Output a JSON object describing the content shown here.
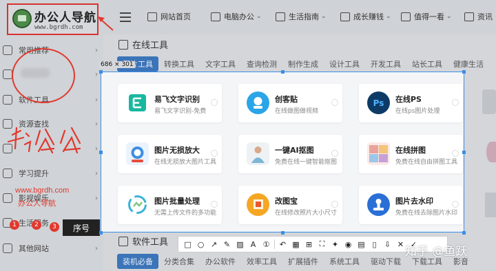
{
  "logo": {
    "title": "办公人导航",
    "url": "www.bgrdh.com"
  },
  "sidebar": {
    "items": [
      {
        "label": "常用推荐"
      },
      {
        "label": ""
      },
      {
        "label": "软件工具"
      },
      {
        "label": "资源查找"
      },
      {
        "label": ""
      },
      {
        "label": "学习提升"
      },
      {
        "label": "影视娱乐"
      },
      {
        "label": "生活服务"
      },
      {
        "label": "其他网站"
      }
    ]
  },
  "topnav": [
    {
      "label": "网站首页",
      "dropdown": false
    },
    {
      "label": "电脑办公",
      "dropdown": true
    },
    {
      "label": "生活指南",
      "dropdown": true
    },
    {
      "label": "成长赚钱",
      "dropdown": true
    },
    {
      "label": "值得一看",
      "dropdown": true
    },
    {
      "label": "资讯",
      "dropdown": false
    }
  ],
  "online_tools": {
    "heading": "在线工具",
    "tabs": [
      "图片工具",
      "转换工具",
      "文字工具",
      "查询检测",
      "制作生成",
      "设计工具",
      "开发工具",
      "站长工具",
      "健康生活"
    ],
    "active_tab": 0
  },
  "software_tools": {
    "heading": "软件工具",
    "tabs": [
      "装机必备",
      "分类合集",
      "办公软件",
      "效率工具",
      "扩展插件",
      "系统工具",
      "驱动下载",
      "下载工具",
      "影音"
    ],
    "active_tab": 0
  },
  "capture": {
    "dimensions": "686 × 301",
    "cards": [
      {
        "title": "易飞文字识别",
        "desc": "易飞文字识别-免费",
        "icon": "text-recognition-icon",
        "color": "#16b7a0"
      },
      {
        "title": "创客贴",
        "desc": "在线做图做视频",
        "icon": "chuangketie-icon",
        "color": "#2aa5e8"
      },
      {
        "title": "在线PS",
        "desc": "在线ps图片处理",
        "icon": "photoshop-icon",
        "color": "#0d3b66"
      },
      {
        "title": "图片无损放大",
        "desc": "在线无损放大图片工具",
        "icon": "image-upscale-icon",
        "color": "#3d8fe0"
      },
      {
        "title": "一键AI抠图",
        "desc": "免费在线一键智能抠图",
        "icon": "ai-cutout-icon",
        "color": "#e9e4de"
      },
      {
        "title": "在线拼图",
        "desc": "免费在线自由拼图工具",
        "icon": "collage-icon",
        "color": "#f2c9c4"
      },
      {
        "title": "图片批量处理",
        "desc": "无需上传文件的多功能",
        "icon": "batch-process-icon",
        "color": "#3ab2d8"
      },
      {
        "title": "改图宝",
        "desc": "在线修改照片大小尺寸",
        "icon": "gaitubao-icon",
        "color": "#f5a623"
      },
      {
        "title": "图片去水印",
        "desc": "免费在线去除图片水印",
        "icon": "watermark-remove-icon",
        "color": "#2a6fd6"
      }
    ]
  },
  "annotations": {
    "watermark_url": "www.bgrdh.com",
    "watermark_name": "办公人导航",
    "handwriting": "办公",
    "badges": [
      "1",
      "2",
      "3"
    ],
    "tooltip": "序号"
  },
  "capture_toolbar": {
    "tools": [
      "rectangle-tool",
      "ellipse-tool",
      "arrow-tool",
      "pen-tool",
      "marker-tool",
      "text-tool",
      "number-tool",
      "undo-tool",
      "mosaic-tool",
      "pin-tool",
      "ocr-tool",
      "pin-screen-tool",
      "record-tool",
      "save-tool",
      "copy-tool",
      "translate-tool",
      "cancel-tool",
      "confirm-tool"
    ]
  },
  "watermark_text": "知乎 @鱼跃"
}
